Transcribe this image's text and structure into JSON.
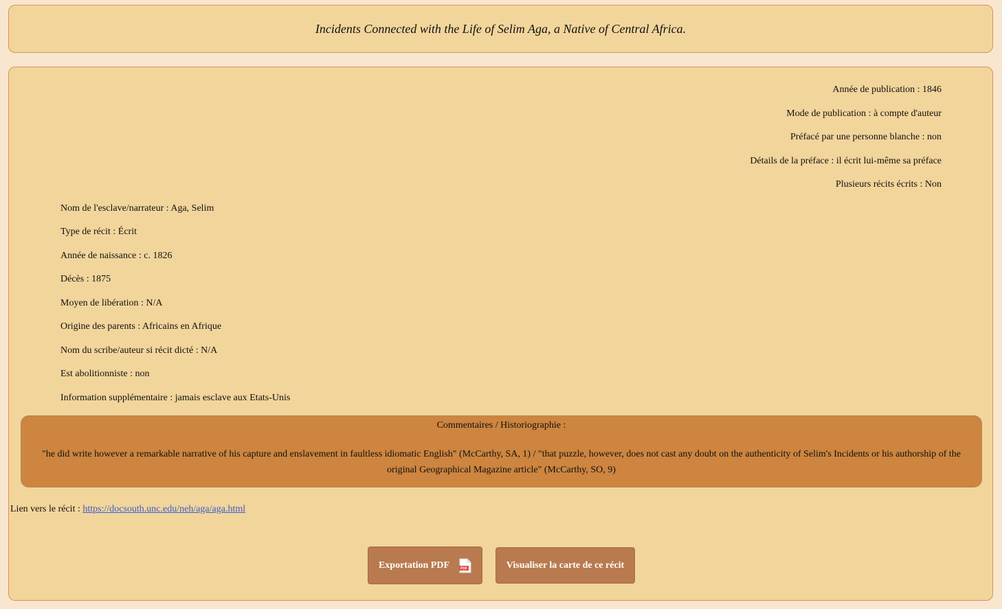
{
  "title": "Incidents Connected with the Life of Selim Aga, a Native of Central Africa.",
  "right_fields": [
    {
      "label": "Année de publication :",
      "value": " 1846"
    },
    {
      "label": "Mode de publication :",
      "value": " à compte d'auteur"
    },
    {
      "label": "Préfacé par une personne blanche :",
      "value": " non"
    },
    {
      "label": "Détails de la préface :",
      "value": " il écrit lui-même sa préface"
    },
    {
      "label": "Plusieurs récits écrits :",
      "value": " Non"
    }
  ],
  "left_fields": [
    {
      "label": "Nom de l'esclave/narrateur :",
      "value": " Aga, Selim"
    },
    {
      "label": "Type de récit :",
      "value": " Écrit"
    },
    {
      "label": "Année de naissance :",
      "value": " c. 1826"
    },
    {
      "label": "Décès :",
      "value": " 1875"
    },
    {
      "label": "Moyen de libération :",
      "value": " N/A"
    },
    {
      "label": "Origine des parents :",
      "value": " Africains en Afrique"
    },
    {
      "label": "Nom du scribe/auteur si récit dicté :",
      "value": " N/A"
    },
    {
      "label": "Est abolitionniste :",
      "value": " non"
    },
    {
      "label": "Information supplémentaire :",
      "value": " jamais esclave aux Etats-Unis"
    }
  ],
  "comments": {
    "heading": "Commentaires / Historiographie :",
    "body": "\"he did write however a remarkable narrative of his capture and enslavement in faultless idiomatic English\" (McCarthy, SA, 1) / \"that puzzle, however, does not cast any doubt on the authenticity of Selim's Incidents or his authorship of the original Geographical Magazine article\" (McCarthy, SO, 9)"
  },
  "link": {
    "label": "Lien vers le récit : ",
    "url_text": "https://docsouth.unc.edu/neh/aga/aga.html"
  },
  "buttons": {
    "pdf_label": "Exportation PDF",
    "pdf_icon": "pdf-file-icon",
    "map_label": "Visualiser la carte de ce récit"
  },
  "colors": {
    "background": "#f9e6cf",
    "panel": "#f2d59b",
    "border": "#d9925a",
    "comment_box": "#cd853f",
    "button": "#b87a4e",
    "link": "#3a5ccf"
  }
}
